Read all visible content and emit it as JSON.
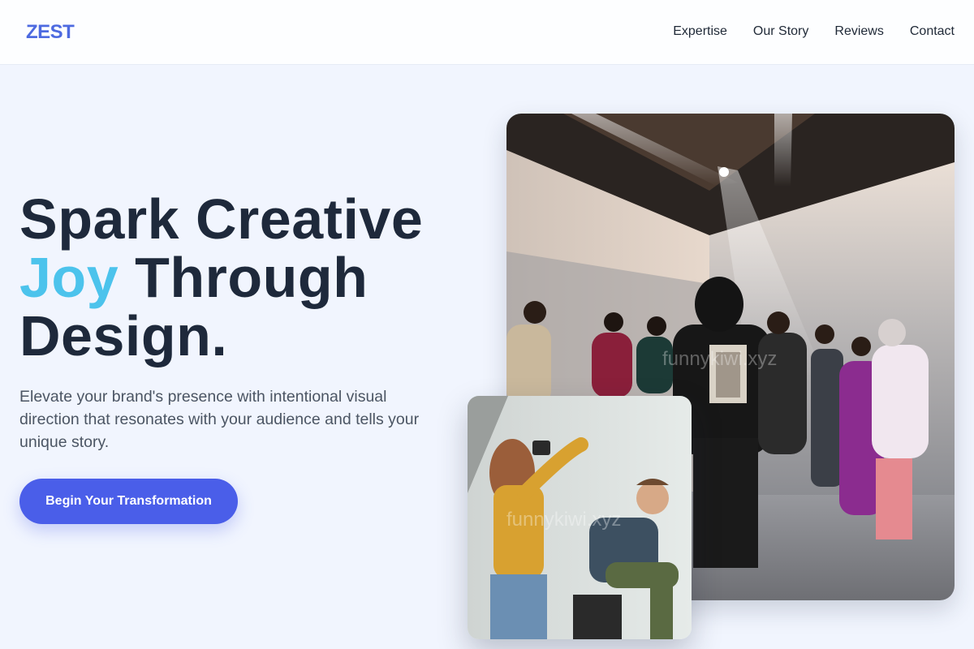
{
  "header": {
    "logo": "ZEST",
    "nav": [
      "Expertise",
      "Our Story",
      "Reviews",
      "Contact"
    ]
  },
  "hero": {
    "title_line1": "Spark Creative",
    "title_accent": "Joy",
    "title_line2_rest": " Through",
    "title_line3": "Design.",
    "subtitle": "Elevate your brand's presence with intentional visual direction that resonates with your audience and tells your unique story.",
    "cta_label": "Begin Your Transformation"
  },
  "images": {
    "main_watermark": "funnykiwi.xyz",
    "small_watermark": "funnykiwi.xyz"
  },
  "colors": {
    "brand": "#4d6ae0",
    "accent": "#4cc3ec",
    "cta": "#4a5ee9",
    "heading": "#1e293b",
    "background": "#f1f5fe"
  }
}
